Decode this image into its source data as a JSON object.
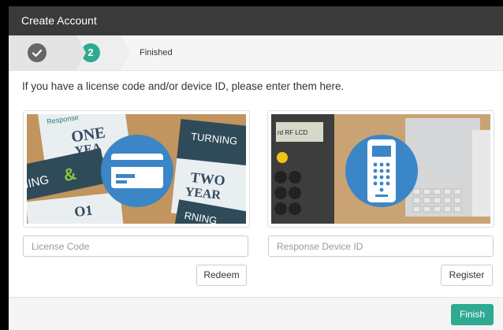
{
  "window": {
    "title": "Create Account"
  },
  "wizard": {
    "steps": [
      {
        "label": "",
        "state": "completed",
        "icon": "check-icon"
      },
      {
        "label": "2",
        "state": "active"
      },
      {
        "label": "Finished",
        "state": "pending"
      }
    ]
  },
  "instructions": "If you have a license code and/or device ID, please enter them here.",
  "license": {
    "image": {
      "icon": "license-card-icon",
      "description": "license cards photo"
    },
    "input_placeholder": "License Code",
    "button_label": "Redeem"
  },
  "device": {
    "image": {
      "icon": "response-device-icon",
      "description": "clicker device photo"
    },
    "input_placeholder": "Response Device ID",
    "button_label": "Register"
  },
  "footer": {
    "finish_label": "Finish"
  },
  "colors": {
    "accent": "#2eaa92",
    "icon_circle": "#3b86c6",
    "titlebar": "#3a3a3a"
  }
}
